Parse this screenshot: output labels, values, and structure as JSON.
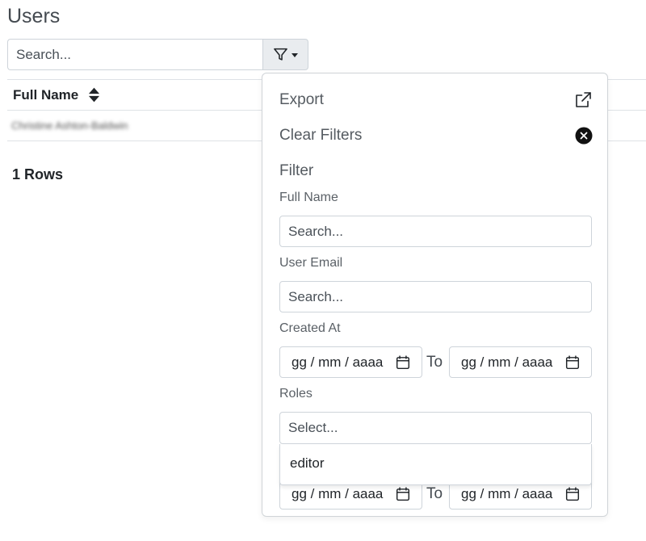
{
  "page": {
    "title": "Users"
  },
  "search": {
    "placeholder": "Search..."
  },
  "table": {
    "columns": [
      {
        "label": "Full Name"
      }
    ],
    "rows": [
      {
        "full_name": "Christine Ashton-Baldwin"
      }
    ]
  },
  "rows_count": "1 Rows",
  "dropdown": {
    "export_label": "Export",
    "clear_filters_label": "Clear Filters",
    "filter_heading": "Filter",
    "fields": {
      "full_name": {
        "label": "Full Name",
        "placeholder": "Search..."
      },
      "user_email": {
        "label": "User Email",
        "placeholder": "Search..."
      },
      "created_at": {
        "label": "Created At",
        "from_placeholder": "gg / mm / aaaa",
        "to_label": "To",
        "to_placeholder": "gg / mm / aaaa"
      },
      "roles": {
        "label": "Roles",
        "placeholder": "Select...",
        "options": [
          "editor"
        ]
      },
      "extra_date": {
        "from_placeholder": "gg / mm / aaaa",
        "to_label": "To",
        "to_placeholder": "gg / mm / aaaa"
      }
    }
  }
}
